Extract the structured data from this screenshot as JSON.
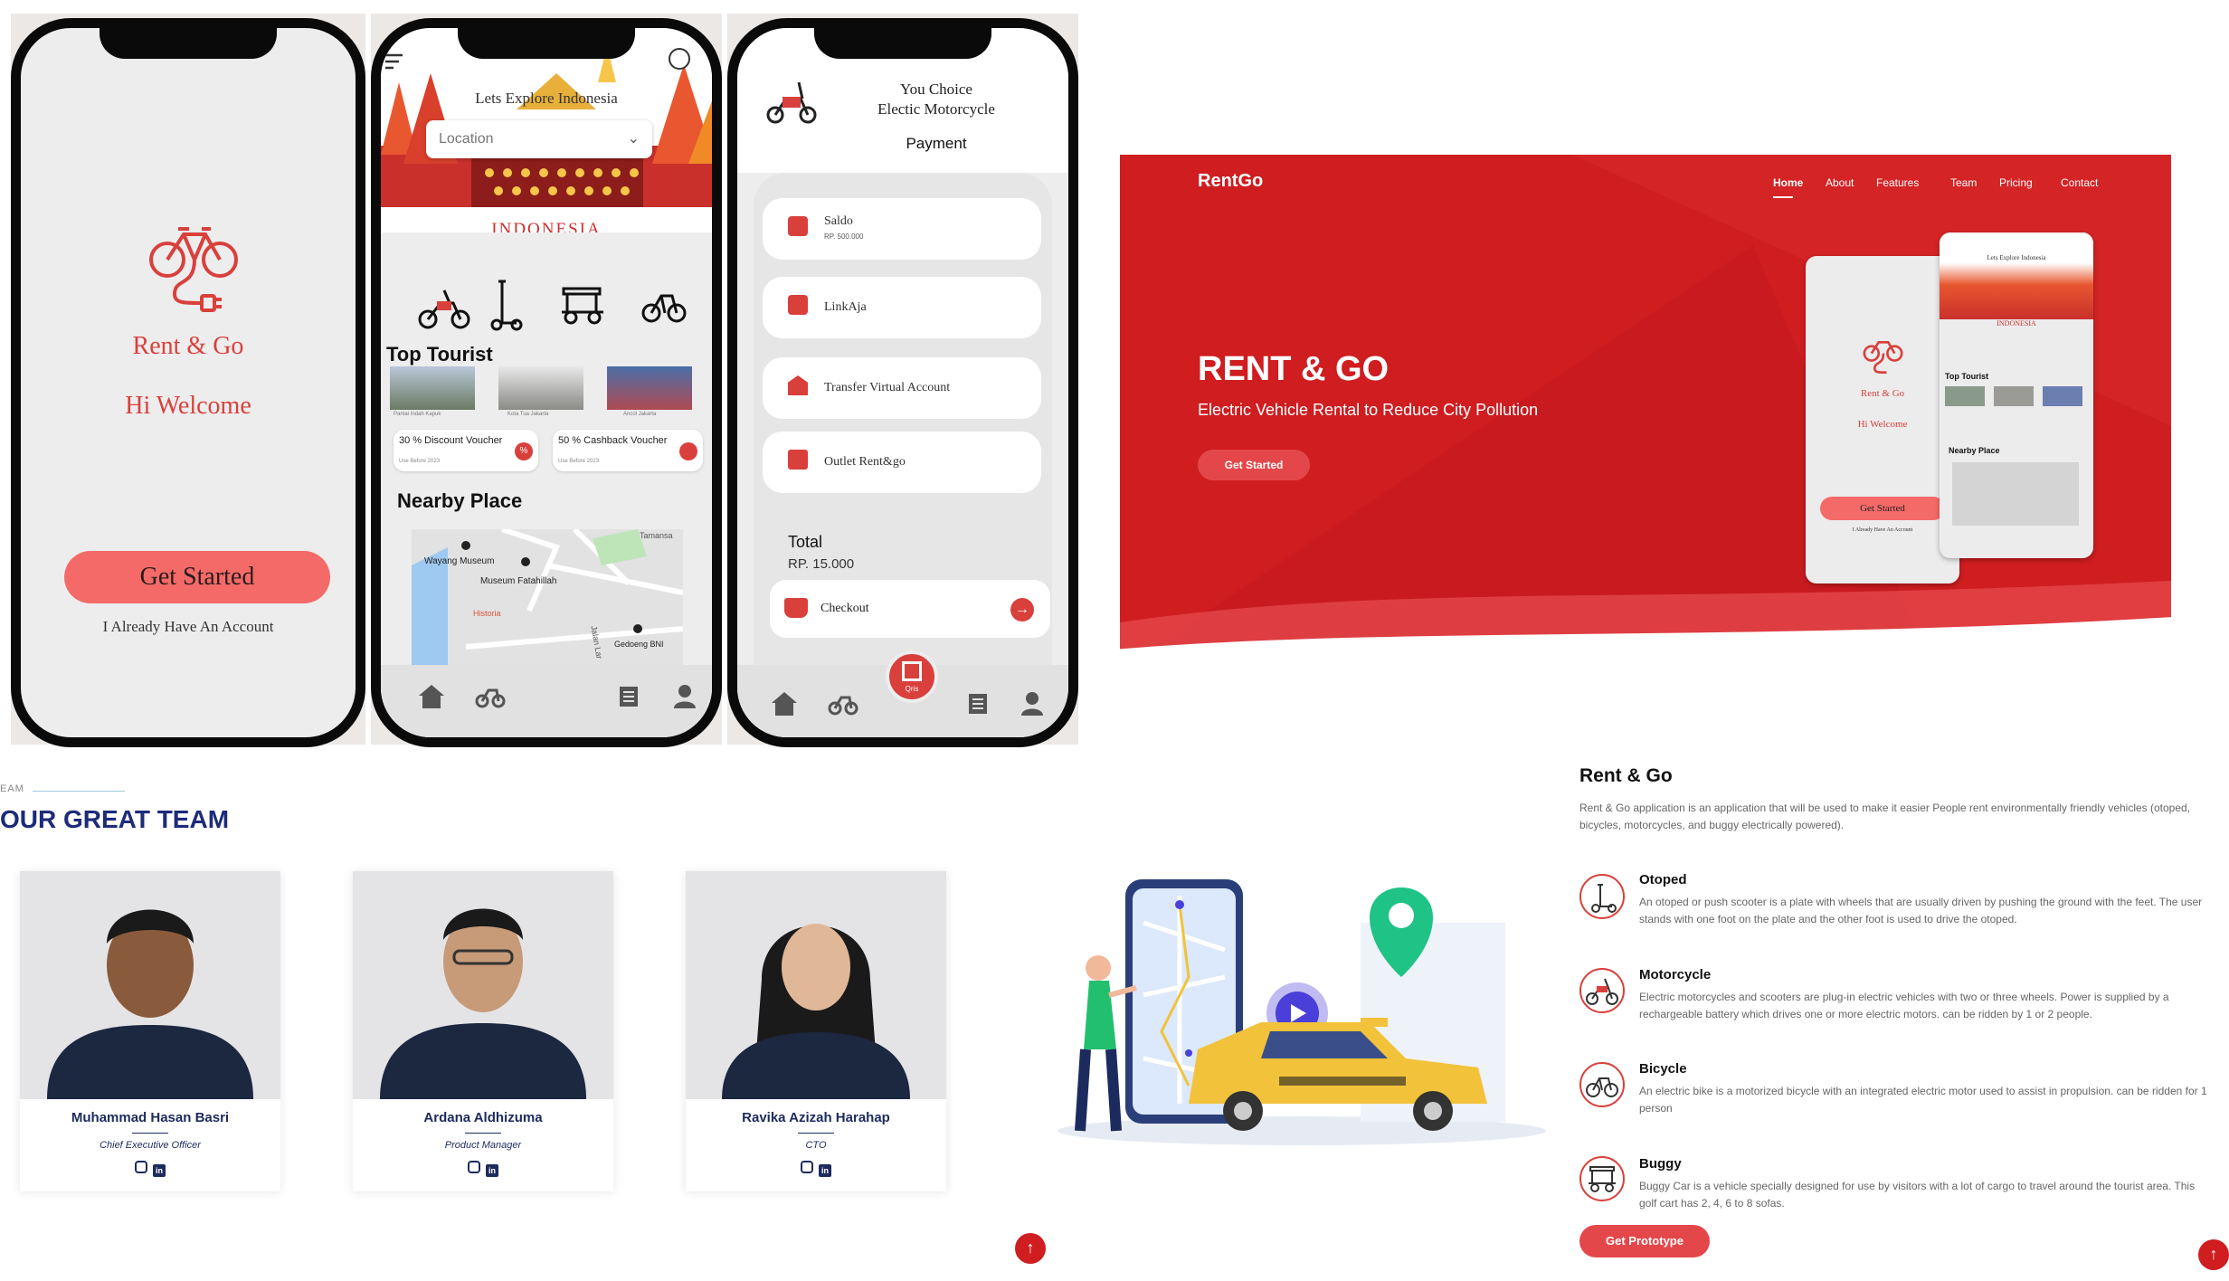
{
  "phone1": {
    "app_title": "Rent & Go",
    "welcome": "Hi Welcome",
    "get_started": "Get Started",
    "have_account": "I Already Have An Account"
  },
  "phone2": {
    "headline": "Lets Explore Indonesia",
    "location_placeholder": "Location",
    "banner": "INDONESIA",
    "top_tourist": "Top Tourist",
    "tourist_captions": [
      "Pantai Indah Kapuk",
      "Kota Tua Jakarta",
      "Ancol Jakarta"
    ],
    "voucher1": "30 % Discount Voucher",
    "voucher1_date": "Use Before 2023",
    "voucher2": "50 % Cashback Voucher",
    "voucher2_date": "Use Before 2023",
    "nearby": "Nearby Place",
    "map_labels": [
      "Tamansa",
      "Wayang Museum",
      "Museum Fatahillah",
      "Historia",
      "Jalan Lar",
      "Gedoeng BNI"
    ]
  },
  "phone3": {
    "choice_line1": "You Choice",
    "choice_line2": "Electic Motorcycle",
    "payment": "Payment",
    "saldo": "Saldo",
    "saldo_amount": "RP. 500.000",
    "linkaja": "LinkAja",
    "transfer": "Transfer Virtual Account",
    "outlet": "Outlet Rent&go",
    "total_label": "Total",
    "total_value": "RP. 15.000",
    "checkout": "Checkout",
    "qris": "Qris"
  },
  "hero": {
    "brand": "RentGo",
    "nav": [
      "Home",
      "About",
      "Features",
      "Team",
      "Pricing",
      "Contact"
    ],
    "title": "RENT & GO",
    "subtitle": "Electric Vehicle Rental to Reduce City Pollution",
    "cta": "Get Started",
    "mock_title": "Rent & Go",
    "mock_welcome": "Hi Welcome",
    "mock_get_started": "Get Started",
    "mock_account": "I Already Have An Account",
    "mock_headline": "Lets Explore Indonesia",
    "mock_banner": "INDONESIA",
    "mock_top": "Top Tourist",
    "mock_nearby": "Nearby Place"
  },
  "team": {
    "eyebrow": "EAM",
    "heading": "OUR GREAT TEAM",
    "members": [
      {
        "name": "Muhammad Hasan Basri",
        "role": "Chief Executive Officer"
      },
      {
        "name": "Ardana Aldhizuma",
        "role": "Product Manager"
      },
      {
        "name": "Ravika Azizah Harahap",
        "role": "CTO"
      }
    ]
  },
  "about": {
    "title": "Rent & Go",
    "intro": "Rent & Go application is an application that will be used to make it easier People rent environmentally friendly vehicles (otoped, bicycles, motorcycles, and buggy electrically powered).",
    "features": [
      {
        "title": "Otoped",
        "desc": "An otoped or push scooter is a plate with wheels that are usually driven by pushing the ground with the feet. The user stands with one foot on the plate and the other foot is used to drive the otoped.",
        "icon": "scooter-icon"
      },
      {
        "title": "Motorcycle",
        "desc": "Electric motorcycles and scooters are plug-in electric vehicles with two or three wheels. Power is supplied by a rechargeable battery which drives one or more electric motors. can be ridden by 1 or 2 people.",
        "icon": "motorcycle-icon"
      },
      {
        "title": "Bicycle",
        "desc": "An electric bike is a motorized bicycle with an integrated electric motor used to assist in propulsion. can be ridden for 1 person",
        "icon": "bicycle-icon"
      },
      {
        "title": "Buggy",
        "desc": "Buggy Car is a vehicle specially designed for use by visitors with a lot of cargo to travel around the tourist area. This golf cart has 2, 4, 6 to 8 sofas.",
        "icon": "buggy-icon"
      }
    ],
    "cta": "Get Prototype"
  },
  "colors": {
    "brand_red": "#cf1d20",
    "accent_coral": "#f46a68",
    "navy": "#1d2b5e"
  }
}
